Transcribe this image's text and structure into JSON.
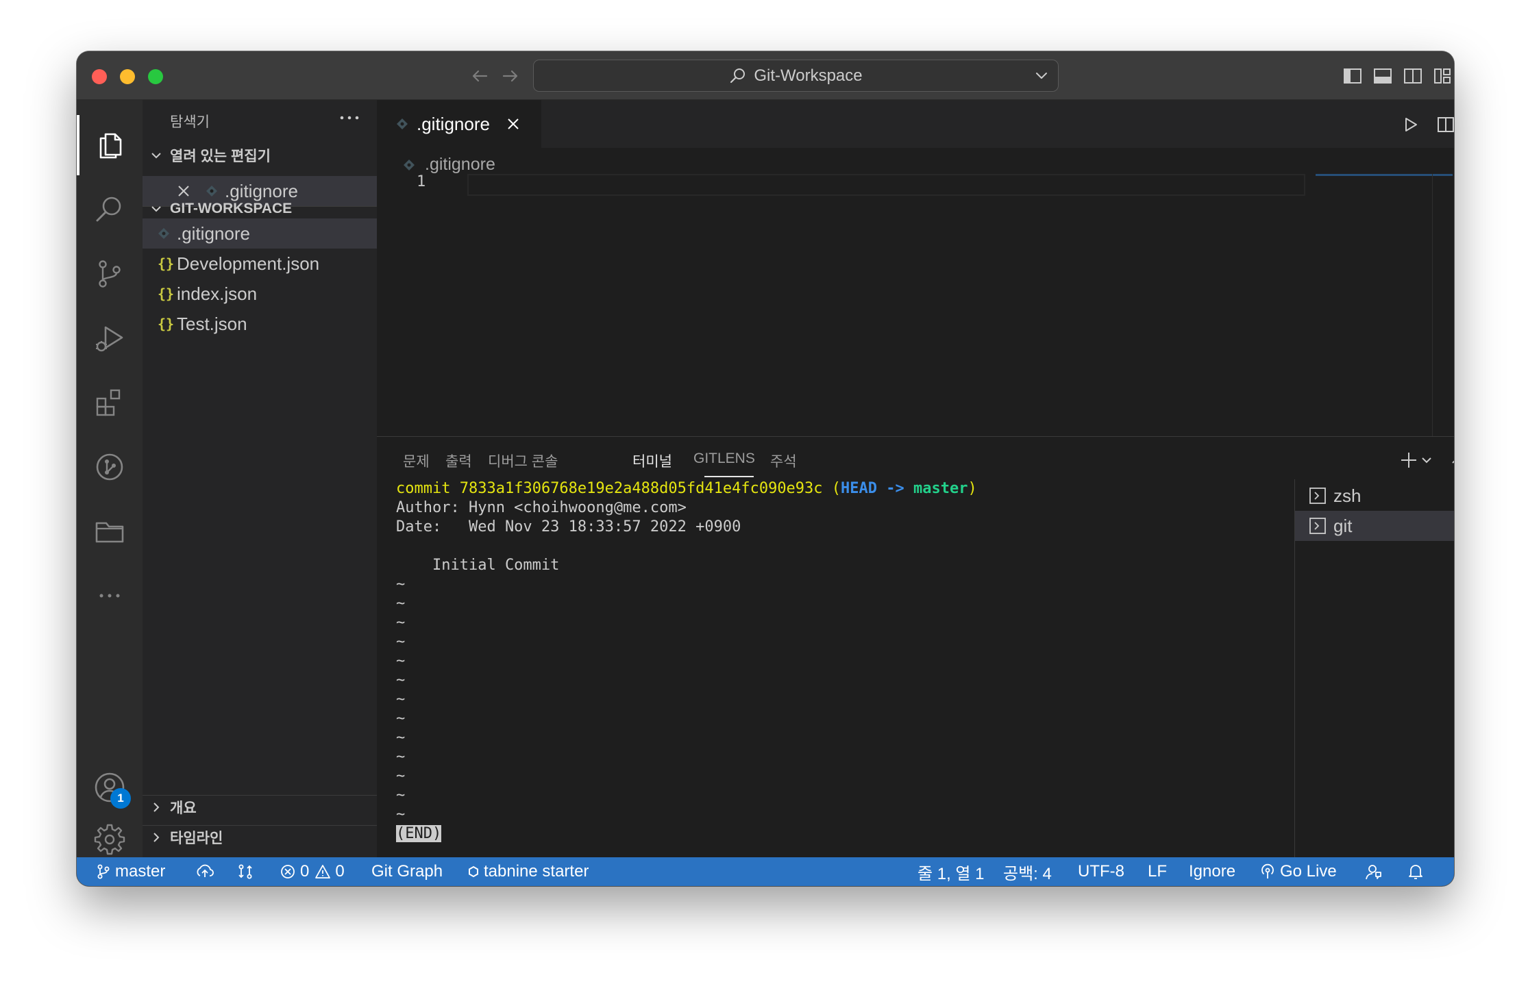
{
  "window": {
    "title": "Git-Workspace"
  },
  "sidebar": {
    "title": "탐색기",
    "open_editors": {
      "header": "열려 있는 편집기",
      "items": [
        ".gitignore"
      ]
    },
    "workspace": {
      "header": "GIT-WORKSPACE",
      "files": [
        {
          "name": ".gitignore",
          "icon": "gitignore-icon"
        },
        {
          "name": "Development.json",
          "icon": "json-icon"
        },
        {
          "name": "index.json",
          "icon": "json-icon"
        },
        {
          "name": "Test.json",
          "icon": "json-icon"
        }
      ]
    },
    "outline_header": "개요",
    "timeline_header": "타임라인"
  },
  "editor": {
    "tab_label": ".gitignore",
    "breadcrumb": ".gitignore",
    "line_number": "1"
  },
  "panel": {
    "tabs": [
      "문제",
      "출력",
      "디버그 콘솔",
      "터미널",
      "GITLENS",
      "주석"
    ],
    "active_tab": "터미널",
    "terminal": {
      "commit_label": "commit",
      "commit_hash": "7833a1f306768e19e2a488d05fd41e4fc090e93c",
      "ref_open": "(",
      "head": "HEAD",
      "arrow": "->",
      "branch": "master",
      "ref_close": ")",
      "author_line": "Author: Hynn <choihwoong@me.com>",
      "date_line": "Date:   Wed Nov 23 18:33:57 2022 +0900",
      "message_line": "    Initial Commit",
      "tilde": "~",
      "end_marker": "(END)"
    },
    "terminal_list": [
      "zsh",
      "git"
    ]
  },
  "statusbar": {
    "branch": "master",
    "errors": "0",
    "warnings": "0",
    "git_graph": "Git Graph",
    "tabnine": "tabnine starter",
    "cursor_position": "줄 1, 열 1",
    "indentation": "공백: 4",
    "encoding": "UTF-8",
    "eol": "LF",
    "language": "Ignore",
    "go_live": "Go Live"
  },
  "accounts_badge": "1",
  "colors": {
    "statusbar": "#2b73c2",
    "activity_bar": "#2c2c2c",
    "sidebar": "#252526",
    "editor": "#1e1e1e",
    "terminal_yellow": "#e5e510",
    "terminal_blue": "#3b8eea",
    "terminal_green": "#23d18b"
  }
}
